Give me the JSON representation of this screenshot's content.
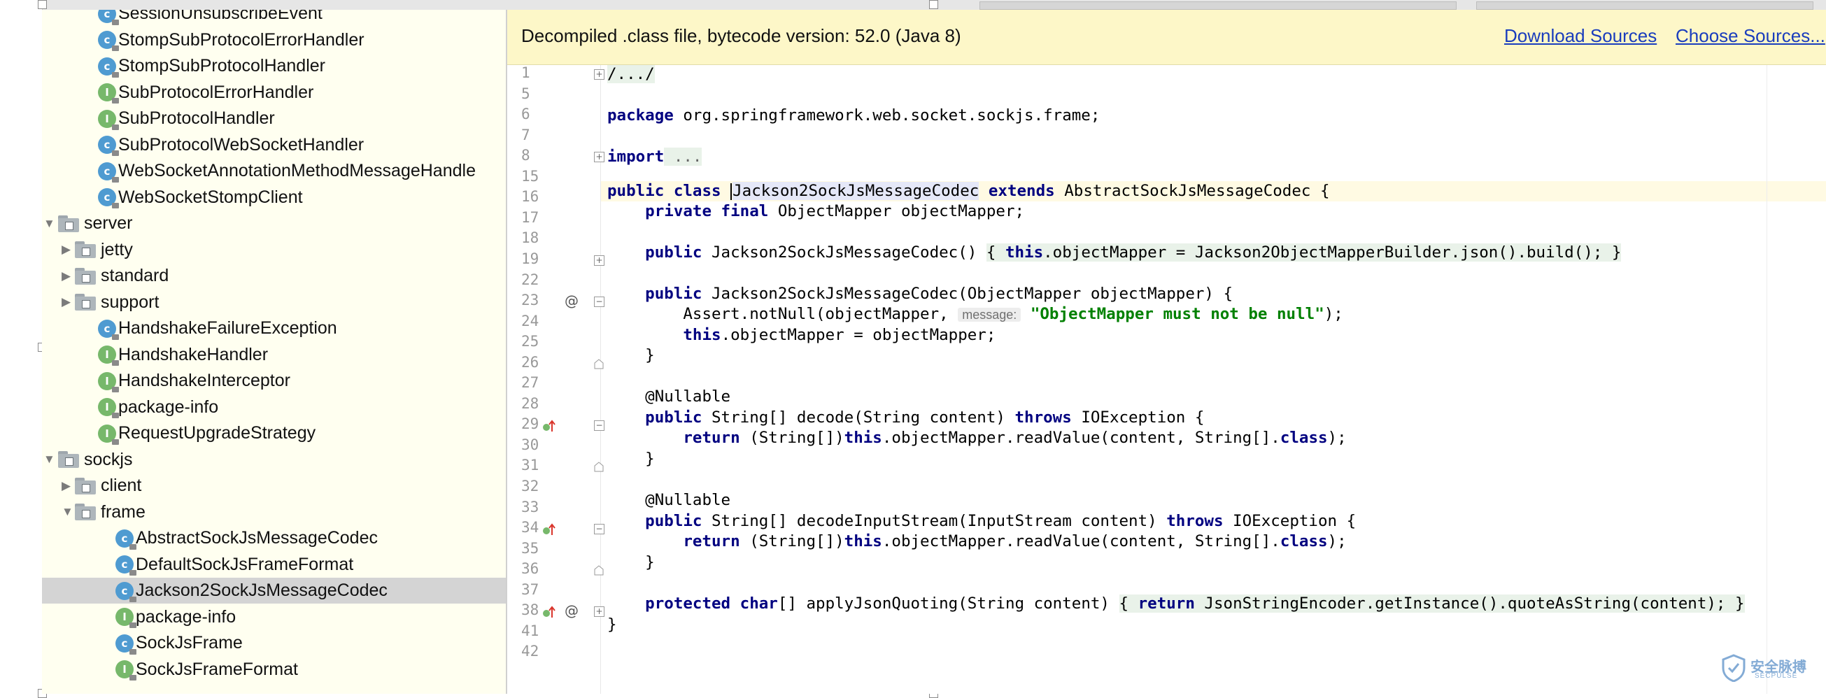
{
  "tree": {
    "items": [
      {
        "label": "SessionUnsubscribeEvent",
        "kind": "class",
        "depth": 2
      },
      {
        "label": "StompSubProtocolErrorHandler",
        "kind": "class",
        "depth": 2
      },
      {
        "label": "StompSubProtocolHandler",
        "kind": "class",
        "depth": 2
      },
      {
        "label": "SubProtocolErrorHandler",
        "kind": "interface",
        "depth": 2
      },
      {
        "label": "SubProtocolHandler",
        "kind": "interface",
        "depth": 2
      },
      {
        "label": "SubProtocolWebSocketHandler",
        "kind": "class",
        "depth": 2
      },
      {
        "label": "WebSocketAnnotationMethodMessageHandle",
        "kind": "class",
        "depth": 2
      },
      {
        "label": "WebSocketStompClient",
        "kind": "class",
        "depth": 2
      },
      {
        "label": "server",
        "kind": "folder-open",
        "depth": 0
      },
      {
        "label": "jetty",
        "kind": "folder-closed",
        "depth": 1
      },
      {
        "label": "standard",
        "kind": "folder-closed",
        "depth": 1
      },
      {
        "label": "support",
        "kind": "folder-closed",
        "depth": 1
      },
      {
        "label": "HandshakeFailureException",
        "kind": "class",
        "depth": 2
      },
      {
        "label": "HandshakeHandler",
        "kind": "interface",
        "depth": 2
      },
      {
        "label": "HandshakeInterceptor",
        "kind": "interface",
        "depth": 2
      },
      {
        "label": "package-info",
        "kind": "interface",
        "depth": 2
      },
      {
        "label": "RequestUpgradeStrategy",
        "kind": "interface",
        "depth": 2
      },
      {
        "label": "sockjs",
        "kind": "folder-open",
        "depth": 0
      },
      {
        "label": "client",
        "kind": "folder-closed",
        "depth": 1
      },
      {
        "label": "frame",
        "kind": "folder-open",
        "depth": 1
      },
      {
        "label": "AbstractSockJsMessageCodec",
        "kind": "class",
        "depth": 3
      },
      {
        "label": "DefaultSockJsFrameFormat",
        "kind": "class",
        "depth": 3
      },
      {
        "label": "Jackson2SockJsMessageCodec",
        "kind": "class",
        "depth": 3,
        "selected": true
      },
      {
        "label": "package-info",
        "kind": "interface",
        "depth": 3
      },
      {
        "label": "SockJsFrame",
        "kind": "class",
        "depth": 3
      },
      {
        "label": "SockJsFrameFormat",
        "kind": "interface",
        "depth": 3
      }
    ]
  },
  "banner": {
    "text": "Decompiled .class file, bytecode version: 52.0 (Java 8)",
    "download_sources": "Download Sources",
    "choose_sources": "Choose Sources..."
  },
  "editor": {
    "lines": [
      {
        "no": "1",
        "fold": "plus"
      },
      {
        "no": "5"
      },
      {
        "no": "6"
      },
      {
        "no": "7"
      },
      {
        "no": "8",
        "fold": "plus"
      },
      {
        "no": "15"
      },
      {
        "no": "16",
        "current": true
      },
      {
        "no": "17"
      },
      {
        "no": "18"
      },
      {
        "no": "19",
        "fold": "plus"
      },
      {
        "no": "22"
      },
      {
        "no": "23",
        "fold": "start",
        "gutter": "at"
      },
      {
        "no": "24"
      },
      {
        "no": "25"
      },
      {
        "no": "26",
        "fold": "end"
      },
      {
        "no": "27"
      },
      {
        "no": "28"
      },
      {
        "no": "29",
        "fold": "start",
        "gutter": "override"
      },
      {
        "no": "30"
      },
      {
        "no": "31",
        "fold": "end"
      },
      {
        "no": "32"
      },
      {
        "no": "33"
      },
      {
        "no": "34",
        "fold": "start",
        "gutter": "override"
      },
      {
        "no": "35"
      },
      {
        "no": "36",
        "fold": "end"
      },
      {
        "no": "37"
      },
      {
        "no": "38",
        "fold": "plus",
        "gutter": "override-at"
      },
      {
        "no": "41"
      },
      {
        "no": "42"
      }
    ],
    "code": {
      "l1_text": "/.../",
      "l6_kw": "package",
      "l6_rest": " org.springframework.web.socket.sockjs.frame;",
      "l8_kw": "import",
      "l8_rest": " ...",
      "l16_kw1": "public class ",
      "l16_name": "Jackson2SockJsMessageCodec",
      "l16_kw2": " extends",
      "l16_rest": " AbstractSockJsMessageCodec {",
      "l17_kw": "    private final",
      "l17_rest": " ObjectMapper objectMapper;",
      "l19_kw": "    public",
      "l19_rest1": " Jackson2SockJsMessageCodec() ",
      "l19_brace_open": "{",
      "l19_kw2": " this",
      "l19_rest2": ".objectMapper = Jackson2ObjectMapperBuilder.json().build(); ",
      "l19_brace_close": "}",
      "l23_kw": "    public",
      "l23_rest": " Jackson2SockJsMessageCodec(ObjectMapper objectMapper) {",
      "l24_pre": "        Assert.notNull(objectMapper, ",
      "l24_hint": "message:",
      "l24_str": "\"ObjectMapper must not be null\"",
      "l24_post": ");",
      "l25_kw": "        this",
      "l25_rest": ".objectMapper = objectMapper;",
      "l26_text": "    }",
      "l28_text": "    @Nullable",
      "l29_kw": "    public",
      "l29_rest1": " String[] decode(String content) ",
      "l29_kw2": "throws",
      "l29_rest2": " IOException {",
      "l30_kw": "        return",
      "l30_rest1": " (String[])",
      "l30_kw2": "this",
      "l30_rest2": ".objectMapper.readValue(content, String[].",
      "l30_kw3": "class",
      "l30_rest3": ");",
      "l31_text": "    }",
      "l33_text": "    @Nullable",
      "l34_kw": "    public",
      "l34_rest1": " String[] decodeInputStream(InputStream content) ",
      "l34_kw2": "throws",
      "l34_rest2": " IOException {",
      "l35_kw": "        return",
      "l35_rest1": " (String[])",
      "l35_kw2": "this",
      "l35_rest2": ".objectMapper.readValue(content, String[].",
      "l35_kw3": "class",
      "l35_rest3": ");",
      "l36_text": "    }",
      "l38_kw": "    protected char",
      "l38_rest1": "[] applyJsonQuoting(String content) ",
      "l38_brace_open": "{",
      "l38_kw2": " return",
      "l38_rest2": " JsonStringEncoder.getInstance().quoteAsString(content); ",
      "l38_brace_close": "}",
      "l41_text": "}"
    }
  },
  "watermark": {
    "cn": "安全脉搏",
    "en": "SECPULSE"
  },
  "colors": {
    "keyword": "#000080",
    "string": "#008000",
    "link": "#1a3dbd",
    "banner_bg": "#fdf7c8",
    "tree_bg": "#fffff0",
    "class_badge": "#4f9bd1",
    "interface_badge": "#77b86b"
  }
}
